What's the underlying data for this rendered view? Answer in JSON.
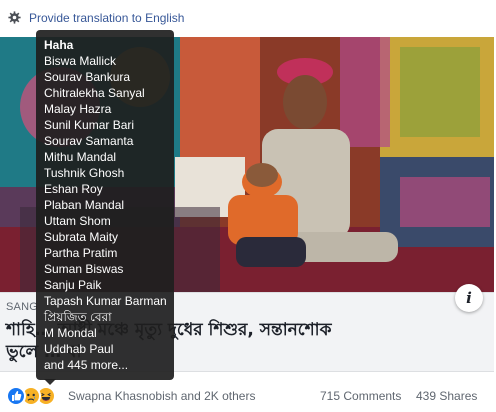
{
  "translate": {
    "label": "Provide translation to English"
  },
  "link_preview": {
    "domain": "SANG",
    "title_line1": "শাহি… আধী মঞ্চে মৃত্যু দুধের শিশুর, সন্তানশোক",
    "title_line2": "ভুলে … বা"
  },
  "info_button": {
    "label": "i"
  },
  "reactions": {
    "summary": "Swapna Khasnobish and 2K others",
    "icons": [
      "like-icon",
      "sad-icon",
      "haha-icon"
    ],
    "colors": {
      "like": "#1877f2",
      "sad": "#f7b125",
      "haha": "#f7b125"
    }
  },
  "counts": {
    "comments": "715 Comments",
    "shares": "439 Shares"
  },
  "tooltip": {
    "title": "Haha",
    "names": [
      "Biswa Mallick",
      "Sourav Bankura",
      "Chitralekha Sanyal",
      "Malay Hazra",
      "Sunil Kumar Bari",
      "Sourav Samanta",
      "Mithu Mandal",
      "Tushnik Ghosh",
      "Eshan Roy",
      "Plaban Mandal",
      "Uttam Shom",
      "Subrata Maity",
      "Partha Pratim",
      "Suman Biswas",
      "Sanju Paik",
      "Tapash Kumar Barman",
      "প্রিয়জিত বেরা",
      "M Mondal",
      "Uddhab Paul"
    ],
    "more": "and 445 more..."
  }
}
